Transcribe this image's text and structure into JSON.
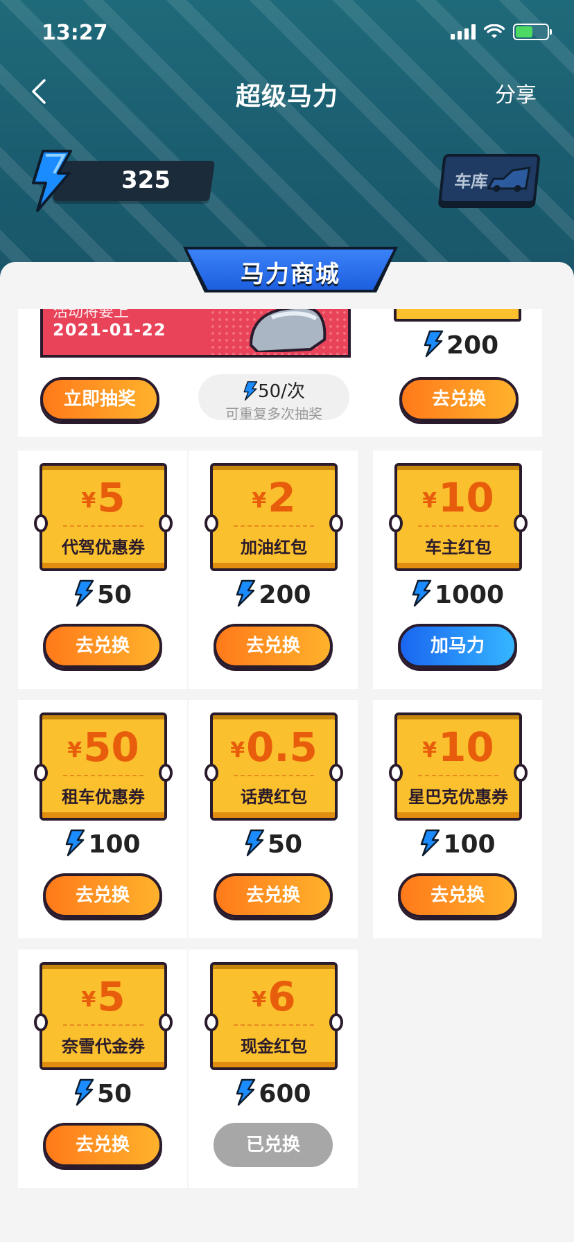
{
  "status_bar": {
    "time": "13:27"
  },
  "nav": {
    "title": "超级马力",
    "share": "分享"
  },
  "power": {
    "value": "325"
  },
  "garage": {
    "label": "车库"
  },
  "shop": {
    "title": "马力商城"
  },
  "top_row": {
    "lottery": {
      "date": "2021-01-22",
      "cut_text": "活动将要上",
      "button": "立即抽奖"
    },
    "cost": {
      "main": "50/次",
      "sub": "可重复多次抽奖"
    },
    "right": {
      "price": "200",
      "button": "去兑换"
    }
  },
  "items": [
    {
      "amount": "5",
      "name": "代驾优惠券",
      "price": "50",
      "button": "去兑换",
      "state": "orange"
    },
    {
      "amount": "2",
      "name": "加油红包",
      "price": "200",
      "button": "去兑换",
      "state": "orange"
    },
    {
      "amount": "10",
      "name": "车主红包",
      "price": "1000",
      "button": "加马力",
      "state": "blue"
    },
    {
      "amount": "50",
      "name": "租车优惠券",
      "price": "100",
      "button": "去兑换",
      "state": "orange"
    },
    {
      "amount": "0.5",
      "name": "话费红包",
      "price": "50",
      "button": "去兑换",
      "state": "orange"
    },
    {
      "amount": "10",
      "name": "星巴克优惠券",
      "price": "100",
      "button": "去兑换",
      "state": "orange"
    },
    {
      "amount": "5",
      "name": "奈雪代金券",
      "price": "50",
      "button": "去兑换",
      "state": "orange"
    },
    {
      "amount": "6",
      "name": "现金红包",
      "price": "600",
      "button": "已兑换",
      "state": "gray"
    }
  ],
  "currency_symbol": "¥",
  "colors": {
    "header": "#1f6a7a",
    "coupon": "#fbc02d",
    "amount": "#e85d0c",
    "orange_btn": "#ff7a1a",
    "blue_btn": "#1a66f0",
    "gray_btn": "#a7a7a7"
  }
}
